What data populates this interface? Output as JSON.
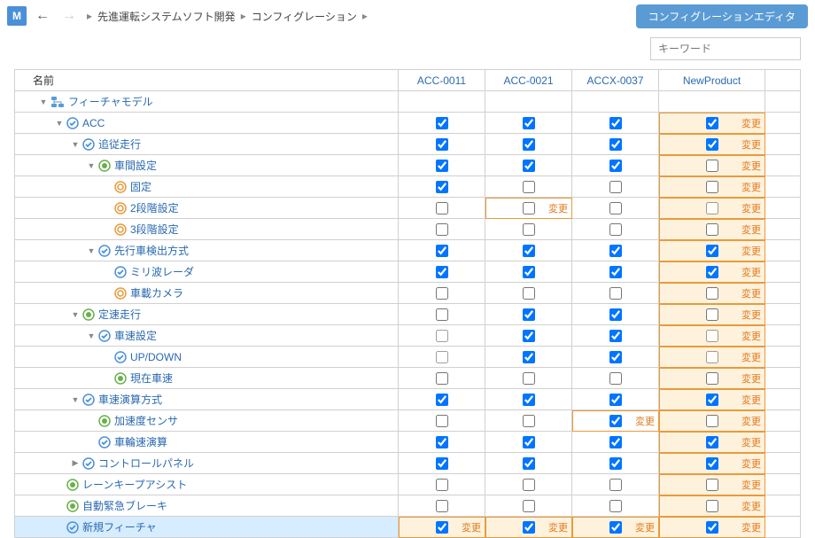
{
  "topbar": {
    "logo": "M",
    "breadcrumb": [
      "先進運転システムソフト開発",
      "コンフィグレーション"
    ],
    "editor_button": "コンフィグレーションエディタ"
  },
  "search": {
    "placeholder": "キーワード"
  },
  "columns": {
    "name": "名前",
    "products": [
      "ACC-0011",
      "ACC-0021",
      "ACCX-0037",
      "NewProduct"
    ]
  },
  "change_label": "変更",
  "rows": [
    {
      "label": "フィーチャモデル",
      "depth": 0,
      "expander": "down",
      "icon": "root",
      "cells": [],
      "is_group_header": true
    },
    {
      "label": "ACC",
      "depth": 1,
      "expander": "down",
      "icon": "check",
      "cells": [
        {
          "c": true
        },
        {
          "c": true
        },
        {
          "c": true
        },
        {
          "c": true,
          "hl": true,
          "ch": true
        }
      ]
    },
    {
      "label": "追従走行",
      "depth": 2,
      "expander": "down",
      "icon": "check",
      "cells": [
        {
          "c": true
        },
        {
          "c": true
        },
        {
          "c": true
        },
        {
          "c": true,
          "hl": true,
          "ch": true
        }
      ]
    },
    {
      "label": "車間設定",
      "depth": 3,
      "expander": "down",
      "icon": "dot",
      "cells": [
        {
          "c": true
        },
        {
          "c": true
        },
        {
          "c": true
        },
        {
          "c": false,
          "hl": true,
          "ch": true
        }
      ]
    },
    {
      "label": "固定",
      "depth": 4,
      "expander": "",
      "icon": "ring",
      "cells": [
        {
          "c": true
        },
        {
          "c": false
        },
        {
          "c": false
        },
        {
          "c": false,
          "hl": true,
          "ch": true
        }
      ]
    },
    {
      "label": "2段階設定",
      "depth": 4,
      "expander": "",
      "icon": "ring",
      "cells": [
        {
          "c": false
        },
        {
          "c": false,
          "ch": true,
          "chlab": true
        },
        {
          "c": false
        },
        {
          "c": false,
          "g": true,
          "hl": true,
          "ch": true
        }
      ]
    },
    {
      "label": "3段階設定",
      "depth": 4,
      "expander": "",
      "icon": "ring",
      "cells": [
        {
          "c": false
        },
        {
          "c": false
        },
        {
          "c": false
        },
        {
          "c": false,
          "hl": true,
          "ch": true
        }
      ]
    },
    {
      "label": "先行車検出方式",
      "depth": 3,
      "expander": "down",
      "icon": "check",
      "cells": [
        {
          "c": true
        },
        {
          "c": true
        },
        {
          "c": true
        },
        {
          "c": true,
          "hl": true,
          "ch": true
        }
      ]
    },
    {
      "label": "ミリ波レーダ",
      "depth": 4,
      "expander": "",
      "icon": "check",
      "cells": [
        {
          "c": true
        },
        {
          "c": true
        },
        {
          "c": true
        },
        {
          "c": true,
          "hl": true,
          "ch": true
        }
      ]
    },
    {
      "label": "車載カメラ",
      "depth": 4,
      "expander": "",
      "icon": "ring",
      "cells": [
        {
          "c": false
        },
        {
          "c": false
        },
        {
          "c": false
        },
        {
          "c": false,
          "hl": true,
          "ch": true
        }
      ]
    },
    {
      "label": "定速走行",
      "depth": 2,
      "expander": "down",
      "icon": "dot",
      "cells": [
        {
          "c": false
        },
        {
          "c": true
        },
        {
          "c": true
        },
        {
          "c": false,
          "hl": true,
          "ch": true
        }
      ]
    },
    {
      "label": "車速設定",
      "depth": 3,
      "expander": "down",
      "icon": "check",
      "cells": [
        {
          "c": false,
          "g": true
        },
        {
          "c": true
        },
        {
          "c": true
        },
        {
          "c": false,
          "g": true,
          "hl": true,
          "ch": true
        }
      ]
    },
    {
      "label": "UP/DOWN",
      "depth": 4,
      "expander": "",
      "icon": "check",
      "cells": [
        {
          "c": false,
          "g": true
        },
        {
          "c": true
        },
        {
          "c": true
        },
        {
          "c": false,
          "g": true,
          "hl": true,
          "ch": true
        }
      ]
    },
    {
      "label": "現在車速",
      "depth": 4,
      "expander": "",
      "icon": "dot",
      "cells": [
        {
          "c": false
        },
        {
          "c": false
        },
        {
          "c": false
        },
        {
          "c": false,
          "hl": true,
          "ch": true
        }
      ]
    },
    {
      "label": "車速演算方式",
      "depth": 2,
      "expander": "down",
      "icon": "check",
      "cells": [
        {
          "c": true
        },
        {
          "c": true
        },
        {
          "c": true
        },
        {
          "c": true,
          "hl": true,
          "ch": true
        }
      ]
    },
    {
      "label": "加速度センサ",
      "depth": 3,
      "expander": "",
      "icon": "dot",
      "cells": [
        {
          "c": false
        },
        {
          "c": false
        },
        {
          "c": true,
          "ch": true,
          "chlab": true
        },
        {
          "c": false,
          "hl": true,
          "ch": true
        }
      ]
    },
    {
      "label": "車輪速演算",
      "depth": 3,
      "expander": "",
      "icon": "check",
      "cells": [
        {
          "c": true
        },
        {
          "c": true
        },
        {
          "c": true
        },
        {
          "c": true,
          "hl": true,
          "ch": true
        }
      ]
    },
    {
      "label": "コントロールパネル",
      "depth": 2,
      "expander": "right",
      "icon": "check",
      "cells": [
        {
          "c": true
        },
        {
          "c": true
        },
        {
          "c": true
        },
        {
          "c": true,
          "hl": true,
          "ch": true
        }
      ]
    },
    {
      "label": "レーンキープアシスト",
      "depth": 1,
      "expander": "",
      "icon": "dot",
      "cells": [
        {
          "c": false
        },
        {
          "c": false
        },
        {
          "c": false
        },
        {
          "c": false,
          "hl": true,
          "ch": true
        }
      ]
    },
    {
      "label": "自動緊急ブレーキ",
      "depth": 1,
      "expander": "",
      "icon": "dot",
      "cells": [
        {
          "c": false
        },
        {
          "c": false
        },
        {
          "c": false
        },
        {
          "c": false,
          "hl": true,
          "ch": true
        }
      ]
    },
    {
      "label": "新規フィーチャ",
      "depth": 1,
      "expander": "",
      "icon": "check",
      "selected": true,
      "cells": [
        {
          "c": true,
          "hl": true,
          "ch": true,
          "chlab": true
        },
        {
          "c": true,
          "hl": true,
          "ch": true,
          "chlab": true
        },
        {
          "c": true,
          "hl": true,
          "ch": true,
          "chlab": true
        },
        {
          "c": true,
          "hl": true,
          "ch": true,
          "chlab": true
        }
      ]
    }
  ]
}
